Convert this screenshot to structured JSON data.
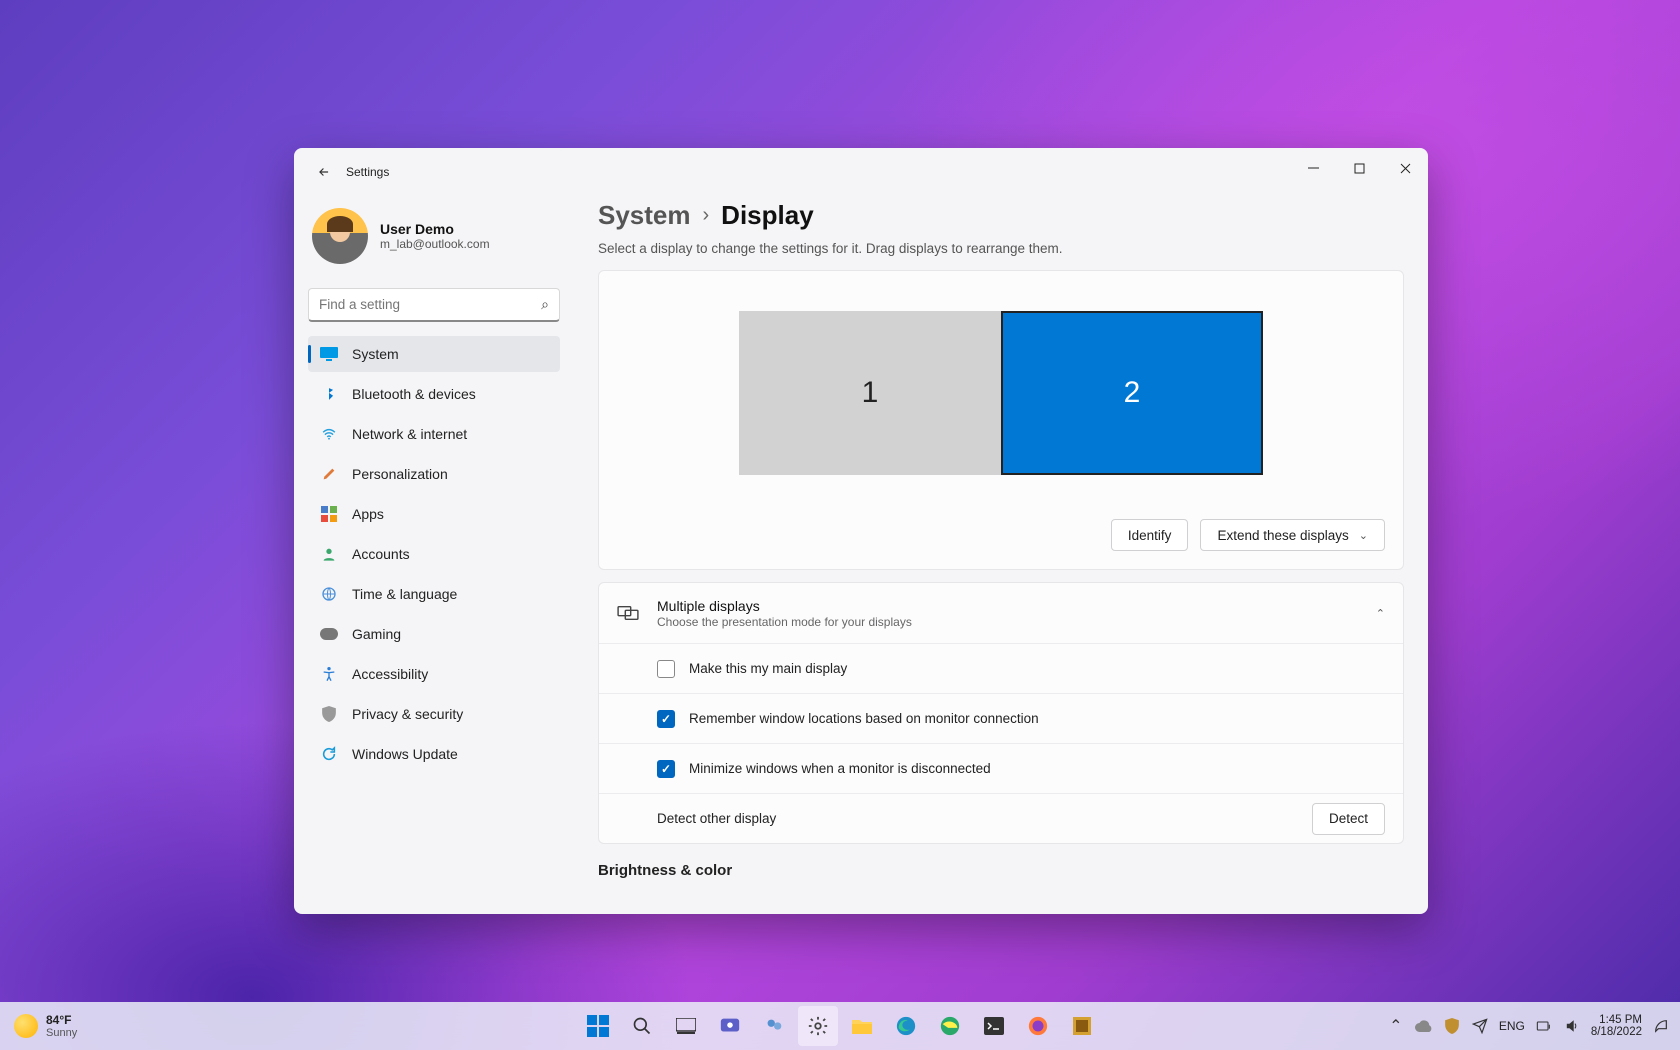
{
  "window": {
    "title": "Settings"
  },
  "profile": {
    "name": "User Demo",
    "email": "m_lab@outlook.com"
  },
  "search": {
    "placeholder": "Find a setting"
  },
  "nav": {
    "items": [
      {
        "label": "System",
        "icon": "display-icon",
        "active": true
      },
      {
        "label": "Bluetooth & devices",
        "icon": "bluetooth-icon"
      },
      {
        "label": "Network & internet",
        "icon": "wifi-icon"
      },
      {
        "label": "Personalization",
        "icon": "brush-icon"
      },
      {
        "label": "Apps",
        "icon": "apps-icon"
      },
      {
        "label": "Accounts",
        "icon": "person-icon"
      },
      {
        "label": "Time & language",
        "icon": "globe-icon"
      },
      {
        "label": "Gaming",
        "icon": "gamepad-icon"
      },
      {
        "label": "Accessibility",
        "icon": "accessibility-icon"
      },
      {
        "label": "Privacy & security",
        "icon": "shield-icon"
      },
      {
        "label": "Windows Update",
        "icon": "update-icon"
      }
    ]
  },
  "breadcrumb": {
    "parent": "System",
    "current": "Display"
  },
  "instruction": "Select a display to change the settings for it. Drag displays to rearrange them.",
  "monitors": {
    "m1": "1",
    "m2": "2",
    "selected": 2
  },
  "buttons": {
    "identify": "Identify",
    "extend": "Extend these displays",
    "detect": "Detect"
  },
  "multiple_displays": {
    "title": "Multiple displays",
    "subtitle": "Choose the presentation mode for your displays",
    "opt_main": "Make this my main display",
    "opt_remember": "Remember window locations based on monitor connection",
    "opt_minimize": "Minimize windows when a monitor is disconnected",
    "detect_label": "Detect other display",
    "main_checked": false,
    "remember_checked": true,
    "minimize_checked": true
  },
  "section_brightness": "Brightness & color",
  "taskbar": {
    "weather_temp": "84°F",
    "weather_cond": "Sunny",
    "lang": "ENG",
    "time": "1:45 PM",
    "date": "8/18/2022"
  }
}
